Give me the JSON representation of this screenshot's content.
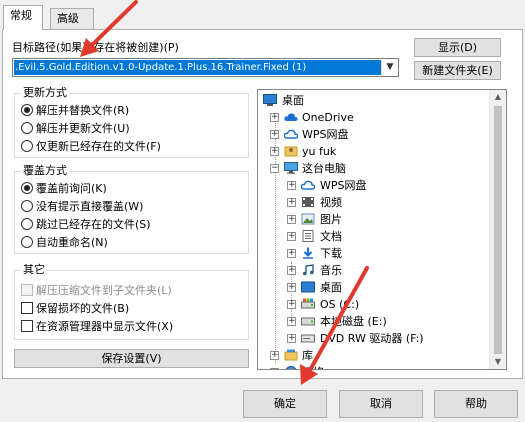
{
  "tabs": [
    {
      "label": "常规",
      "active": true
    },
    {
      "label": "高级",
      "active": false
    }
  ],
  "target_path": {
    "label": "目标路径(如果不存在将被创建)(P)",
    "value": ".Evil.5.Gold.Edition.v1.0-Update.1.Plus.16.Trainer.Fixed (1)"
  },
  "buttons": {
    "show": "显示(D)",
    "new_folder": "新建文件夹(E)",
    "save_settings": "保存设置(V)",
    "ok": "确定",
    "cancel": "取消",
    "help": "帮助"
  },
  "update_mode": {
    "title": "更新方式",
    "options": [
      {
        "label": "解压并替换文件(R)",
        "selected": true
      },
      {
        "label": "解压并更新文件(U)",
        "selected": false
      },
      {
        "label": "仅更新已经存在的文件(F)",
        "selected": false
      }
    ]
  },
  "overwrite_mode": {
    "title": "覆盖方式",
    "options": [
      {
        "label": "覆盖前询问(K)",
        "selected": true
      },
      {
        "label": "没有提示直接覆盖(W)",
        "selected": false
      },
      {
        "label": "跳过已经存在的文件(S)",
        "selected": false
      },
      {
        "label": "自动重命名(N)",
        "selected": false
      }
    ]
  },
  "other": {
    "title": "其它",
    "options": [
      {
        "label": "解压压缩文件到子文件夹(L)",
        "checked": false,
        "disabled": true
      },
      {
        "label": "保留损坏的文件(B)",
        "checked": false,
        "disabled": false
      },
      {
        "label": "在资源管理器中显示文件(X)",
        "checked": false,
        "disabled": false
      }
    ]
  },
  "tree": {
    "nodes": [
      {
        "label": "桌面",
        "icon": "desktop-icon"
      },
      {
        "label": "OneDrive",
        "icon": "cloud-icon"
      },
      {
        "label": "WPS网盘",
        "icon": "cloud-icon"
      },
      {
        "label": "yu fuk",
        "icon": "user-folder-icon"
      },
      {
        "label": "这台电脑",
        "icon": "computer-icon"
      },
      {
        "label": "WPS网盘",
        "icon": "cloud-icon"
      },
      {
        "label": "视频",
        "icon": "video-folder-icon"
      },
      {
        "label": "图片",
        "icon": "pictures-folder-icon"
      },
      {
        "label": "文档",
        "icon": "documents-folder-icon"
      },
      {
        "label": "下载",
        "icon": "downloads-folder-icon"
      },
      {
        "label": "音乐",
        "icon": "music-folder-icon"
      },
      {
        "label": "桌面",
        "icon": "desktop-folder-icon"
      },
      {
        "label": "OS (C:)",
        "icon": "drive-icon"
      },
      {
        "label": "本地磁盘 (E:)",
        "icon": "drive-icon"
      },
      {
        "label": "DVD RW 驱动器 (F:)",
        "icon": "dvd-drive-icon"
      },
      {
        "label": "库",
        "icon": "library-icon"
      },
      {
        "label": "网络",
        "icon": "network-icon"
      }
    ]
  },
  "colors": {
    "selection": "#0078d7",
    "annotation_arrow": "#e03a2e"
  }
}
